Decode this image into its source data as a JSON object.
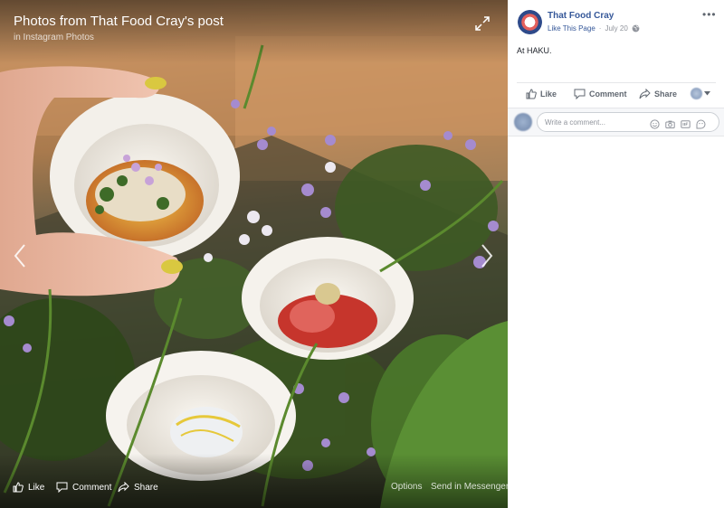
{
  "viewer": {
    "title": "Photos from That Food Cray's post",
    "subtitle": "in Instagram Photos",
    "bottom_bar": {
      "like_label": "Like",
      "comment_label": "Comment",
      "share_label": "Share",
      "options_label": "Options",
      "messenger_label": "Send in Messenger"
    }
  },
  "sidebar": {
    "page_name": "That Food Cray",
    "like_page_label": "Like This Page",
    "separator": "·",
    "date": "July 20",
    "post_text": "At HAKU.",
    "actions": {
      "like_label": "Like",
      "comment_label": "Comment",
      "share_label": "Share"
    },
    "comment_box": {
      "placeholder": "Write a comment..."
    }
  },
  "icons": {
    "expand": "expand-icon",
    "prev": "chevron-left-icon",
    "next": "chevron-right-icon",
    "more": "more-dots-icon",
    "globe": "globe-icon",
    "like": "thumbs-up-icon",
    "comment": "comment-bubble-icon",
    "share": "share-arrow-icon",
    "emoji": "emoji-icon",
    "camera": "camera-icon",
    "gif": "gif-icon",
    "sticker": "sticker-icon"
  },
  "colors": {
    "link_blue": "#365899",
    "text_gray": "#90949c",
    "action_gray": "#606770"
  }
}
